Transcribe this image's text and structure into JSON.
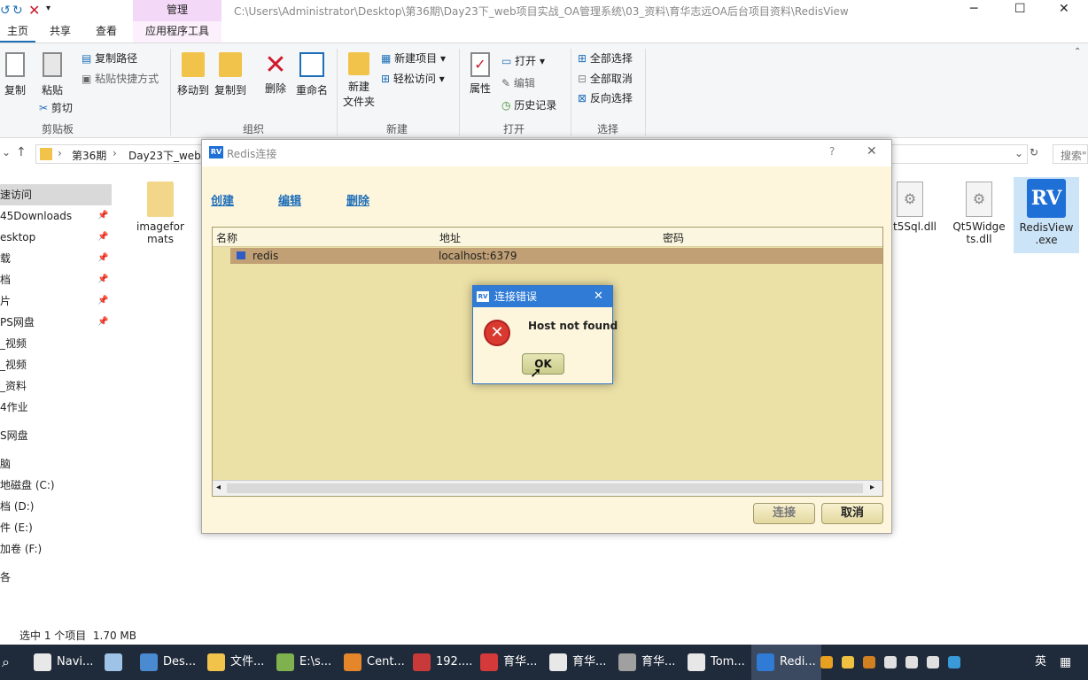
{
  "window": {
    "path": "C:\\Users\\Administrator\\Desktop\\第36期\\Day23下_web项目实战_OA管理系统\\03_资料\\育华志远OA后台项目资料\\RedisView",
    "manage_tab": "管理",
    "app_tools_tab": "应用程序工具"
  },
  "ribbon_tabs": [
    "主页",
    "共享",
    "查看"
  ],
  "ribbon": {
    "copy": "复制",
    "paste": "粘贴",
    "copy_path": "复制路径",
    "paste_shortcut": "粘贴快捷方式",
    "cut": "剪切",
    "clipboard_group": "剪贴板",
    "move_to": "移动到",
    "copy_to": "复制到",
    "delete": "删除",
    "rename": "重命名",
    "organize_group": "组织",
    "new_folder_l1": "新建",
    "new_folder_l2": "文件夹",
    "new_item": "新建项目",
    "easy_access": "轻松访问",
    "new_group": "新建",
    "properties": "属性",
    "open": "打开",
    "edit": "编辑",
    "history": "历史记录",
    "open_group": "打开",
    "select_all": "全部选择",
    "select_none": "全部取消",
    "invert_selection": "反向选择",
    "select_group": "选择"
  },
  "address": {
    "crumb1": "第36期",
    "crumb2": "Day23下_web项",
    "search_placeholder": "搜索\""
  },
  "nav_items": [
    {
      "label": "速访问",
      "pinned": false
    },
    {
      "label": "45Downloads",
      "pinned": true
    },
    {
      "label": "esktop",
      "pinned": true
    },
    {
      "label": "载",
      "pinned": true
    },
    {
      "label": "档",
      "pinned": true
    },
    {
      "label": "片",
      "pinned": true
    },
    {
      "label": "PS网盘",
      "pinned": true
    },
    {
      "label": "_视频",
      "pinned": false
    },
    {
      "label": "_视频",
      "pinned": false
    },
    {
      "label": "_资料",
      "pinned": false
    },
    {
      "label": "4作业",
      "pinned": false
    },
    {
      "label": "S网盘",
      "pinned": false
    },
    {
      "label": "脑",
      "pinned": false
    },
    {
      "label": "地磁盘 (C:)",
      "pinned": false
    },
    {
      "label": "档 (D:)",
      "pinned": false
    },
    {
      "label": "件 (E:)",
      "pinned": false
    },
    {
      "label": "加卷 (F:)",
      "pinned": false
    },
    {
      "label": "各",
      "pinned": false
    }
  ],
  "files": {
    "imageformats_l1": "imagefor",
    "imageformats_l2": "mats",
    "qt5sql": "t5Sql.dll",
    "qt5widgets_l1": "Qt5Widge",
    "qt5widgets_l2": "ts.dll",
    "redisview_l1": "RedisView",
    "redisview_l2": ".exe"
  },
  "status": {
    "text": "选中 1 个项目  1.70 MB"
  },
  "redis_dialog": {
    "title": "Redis连接",
    "help": "?",
    "close": "✕",
    "create": "创建",
    "edit": "编辑",
    "delete": "删除",
    "col_name": "名称",
    "col_address": "地址",
    "col_password": "密码",
    "row": {
      "name": "redis",
      "address": "localhost:6379",
      "password": ""
    },
    "connect": "连接",
    "cancel": "取消"
  },
  "error_dialog": {
    "title": "连接错误",
    "message": "Host not found",
    "ok": "OK"
  },
  "taskbar": {
    "items": [
      {
        "label": "Navi...",
        "color": "#e8e8e8"
      },
      {
        "label": "Des...",
        "color": "#4a8ad1"
      },
      {
        "label": "文件...",
        "color": "#f2c34a"
      },
      {
        "label": "E:\\s...",
        "color": "#7fb24e"
      },
      {
        "label": "Cent...",
        "color": "#e6862a"
      },
      {
        "label": "192....",
        "color": "#c83a3a"
      },
      {
        "label": "育华...",
        "color": "#d43a3a"
      },
      {
        "label": "育华...",
        "color": "#e8e8e8"
      },
      {
        "label": "育华...",
        "color": "#a0a0a0"
      },
      {
        "label": "Tom...",
        "color": "#e7e7e7"
      },
      {
        "label": "Redi...",
        "color": "#2f7bd6"
      }
    ],
    "ime": "英"
  }
}
